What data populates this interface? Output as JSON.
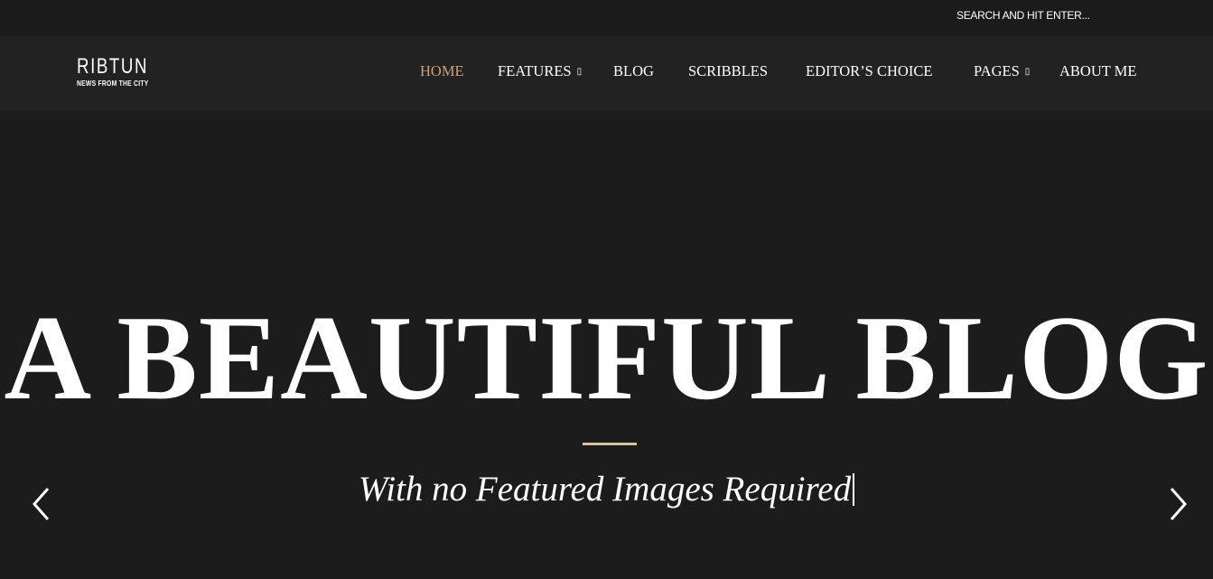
{
  "search": {
    "placeholder": "SEARCH AND HIT ENTER..."
  },
  "logo": {
    "title": "RIBTUN",
    "tagline": "NEWS FROM THE CITY"
  },
  "nav": {
    "items": [
      {
        "label": "HOME",
        "active": true
      },
      {
        "label": "FEATURES",
        "dropdown": true
      },
      {
        "label": "BLOG"
      },
      {
        "label": "SCRIBBLES"
      },
      {
        "label": "EDITOR’S CHOICE"
      },
      {
        "label": "PAGES",
        "dropdown": true
      },
      {
        "label": "ABOUT ME"
      }
    ],
    "dropdown_glyph": "▯"
  },
  "hero": {
    "title": "A BEAUTIFUL BLOG",
    "subtitle": "With no Featured Images Required"
  },
  "colors": {
    "accent": "#c8a27a",
    "divider": "#d8c39a",
    "background": "#1c1c1c",
    "nav_bg": "#222222"
  }
}
